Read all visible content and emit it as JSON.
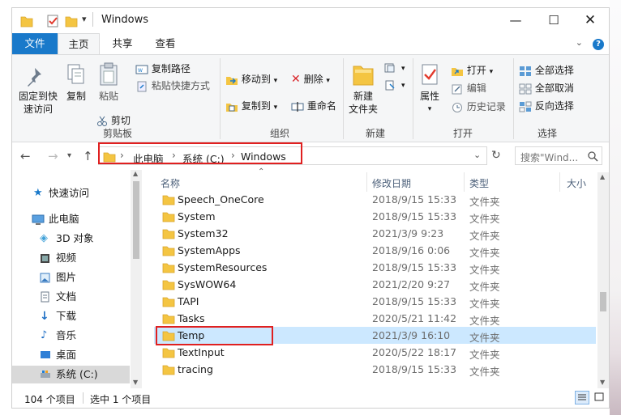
{
  "window": {
    "title": "Windows",
    "controls": [
      "minimize",
      "maximize",
      "close"
    ]
  },
  "ribbon_tabs": {
    "file": "文件",
    "home": "主页",
    "share": "共享",
    "view": "查看"
  },
  "ribbon": {
    "clipboard": {
      "group_label": "剪贴板",
      "pin": "固定到快速访问",
      "pin_line1": "固定到快",
      "pin_line2": "速访问",
      "copy": "复制",
      "paste": "粘贴",
      "copy_path": "复制路径",
      "paste_shortcut": "粘贴快捷方式",
      "cut": "剪切"
    },
    "organize": {
      "group_label": "组织",
      "move_to": "移动到",
      "copy_to": "复制到",
      "delete": "删除",
      "rename": "重命名"
    },
    "new": {
      "group_label": "新建",
      "new_folder_line1": "新建",
      "new_folder_line2": "文件夹"
    },
    "open": {
      "group_label": "打开",
      "properties": "属性",
      "open": "打开",
      "edit": "编辑",
      "history": "历史记录"
    },
    "select": {
      "group_label": "选择",
      "select_all": "全部选择",
      "select_none": "全部取消",
      "invert": "反向选择"
    }
  },
  "address": {
    "crumbs": [
      "此电脑",
      "系统 (C:)",
      "Windows"
    ],
    "search_placeholder": "搜索\"Wind..."
  },
  "nav_pane": {
    "quick_access": "快速访问",
    "this_pc": "此电脑",
    "items": [
      "3D 对象",
      "视频",
      "图片",
      "文档",
      "下载",
      "音乐",
      "桌面",
      "系统 (C:)"
    ]
  },
  "columns": {
    "name": "名称",
    "date": "修改日期",
    "type": "类型",
    "size": "大小"
  },
  "files": [
    {
      "name": "Speech_OneCore",
      "date": "2018/9/15 15:33",
      "type": "文件夹"
    },
    {
      "name": "System",
      "date": "2018/9/15 15:33",
      "type": "文件夹"
    },
    {
      "name": "System32",
      "date": "2021/3/9 9:23",
      "type": "文件夹"
    },
    {
      "name": "SystemApps",
      "date": "2018/9/16 0:06",
      "type": "文件夹"
    },
    {
      "name": "SystemResources",
      "date": "2018/9/15 15:33",
      "type": "文件夹"
    },
    {
      "name": "SysWOW64",
      "date": "2021/2/20 9:27",
      "type": "文件夹"
    },
    {
      "name": "TAPI",
      "date": "2018/9/15 15:33",
      "type": "文件夹"
    },
    {
      "name": "Tasks",
      "date": "2020/5/21 11:42",
      "type": "文件夹"
    },
    {
      "name": "Temp",
      "date": "2021/3/9 16:10",
      "type": "文件夹"
    },
    {
      "name": "TextInput",
      "date": "2020/5/22 18:17",
      "type": "文件夹"
    },
    {
      "name": "tracing",
      "date": "2018/9/15 15:33",
      "type": "文件夹"
    }
  ],
  "selected_file": "Temp",
  "status": {
    "count": "104 个项目",
    "selected": "选中 1 个项目"
  },
  "colors": {
    "accent": "#1979ca",
    "selection": "#cce8ff",
    "highlight_box": "#e02020",
    "folder": "#f4c542"
  }
}
